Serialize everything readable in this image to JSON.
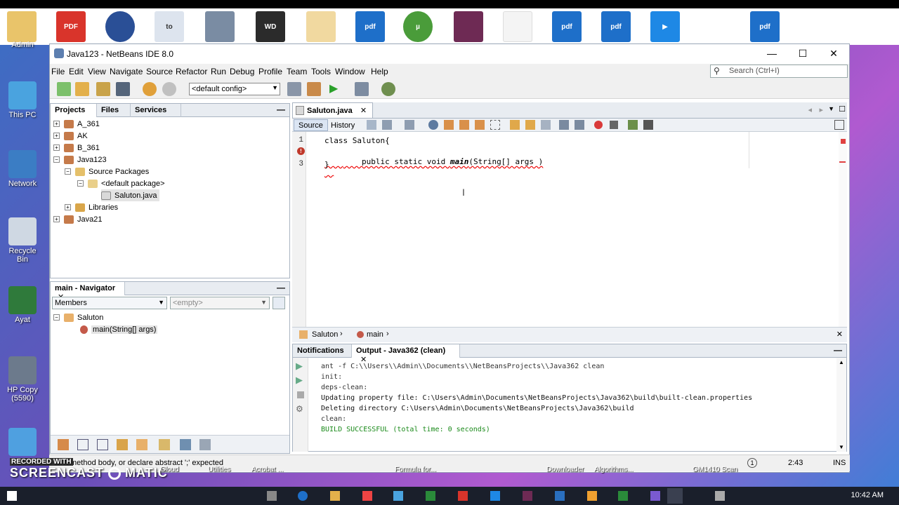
{
  "desktop": {
    "icons": [
      "Admin",
      "This PC",
      "Network",
      "Recycle Bin",
      "Ayat",
      "HP Copy (5590)"
    ]
  },
  "window": {
    "title": "Java123 - NetBeans IDE 8.0",
    "controls": {
      "minimize": "—",
      "maximize": "☐",
      "close": "✕"
    }
  },
  "menu": [
    "File",
    "Edit",
    "View",
    "Navigate",
    "Source",
    "Refactor",
    "Run",
    "Debug",
    "Profile",
    "Team",
    "Tools",
    "Window",
    "Help"
  ],
  "search": {
    "placeholder": "Search (Ctrl+I)"
  },
  "toolbar": {
    "config": "<default config>"
  },
  "projects_panel": {
    "tabs": [
      "Projects",
      "Files",
      "Services"
    ],
    "tree": [
      {
        "label": "A_361",
        "level": 0,
        "expander": "+"
      },
      {
        "label": "AK",
        "level": 0,
        "expander": "+"
      },
      {
        "label": "B_361",
        "level": 0,
        "expander": "+"
      },
      {
        "label": "Java123",
        "level": 0,
        "expander": "−"
      },
      {
        "label": "Source Packages",
        "level": 1,
        "expander": "−"
      },
      {
        "label": "<default package>",
        "level": 2,
        "expander": "−"
      },
      {
        "label": "Saluton.java",
        "level": 3,
        "expander": ""
      },
      {
        "label": "Libraries",
        "level": 1,
        "expander": "+"
      },
      {
        "label": "Java21",
        "level": 0,
        "expander": "+"
      }
    ]
  },
  "navigator_panel": {
    "tab": "main - Navigator",
    "members_select": "Members",
    "filter_select": "<empty>",
    "tree": [
      {
        "label": "Saluton",
        "level": 0
      },
      {
        "label": "main(String[] args)",
        "level": 1
      }
    ]
  },
  "editor": {
    "tab": "Saluton.java",
    "source_btn": "Source",
    "history_btn": "History",
    "lines": [
      {
        "num": "1",
        "text": "class Saluton{"
      },
      {
        "num": "2",
        "prefix": "    public static void ",
        "method": "main",
        "suffix": "(String[] args )"
      },
      {
        "num": "3",
        "text": "}"
      }
    ],
    "breadcrumb": [
      "Saluton",
      "main"
    ]
  },
  "output_panel": {
    "tabs": [
      "Notifications",
      "Output - Java362 (clean)"
    ],
    "lines": [
      "ant -f C:\\\\Users\\\\Admin\\\\Documents\\\\NetBeansProjects\\\\Java362 clean",
      "init:",
      "deps-clean:",
      "Updating property file: C:\\Users\\Admin\\Documents\\NetBeansProjects\\Java362\\build\\built-clean.properties",
      "Deleting directory C:\\Users\\Admin\\Documents\\NetBeansProjects\\Java362\\build",
      "clean:",
      "BUILD SUCCESSFUL (total time: 0 seconds)"
    ]
  },
  "statusbar": {
    "message": "method body, or declare abstract ';' expected",
    "position": "2:43",
    "mode": "INS",
    "notif_count": "1"
  },
  "watermark": {
    "line1": "RECORDED WITH",
    "line2": "SCREENCAST",
    "line3": "MATIC"
  },
  "taskbar": {
    "labels": [
      "Gloud",
      "Utilities",
      "Acrobat ...",
      "Formula for...",
      "Downloader",
      "Algorithms...",
      "GM1410 Scan"
    ],
    "time": "10:42 AM"
  },
  "colors": {
    "success": "#1a8a1a",
    "error": "#dd0000",
    "editor_bg": "#ffffff",
    "panel_header": "#e8ecf1"
  }
}
